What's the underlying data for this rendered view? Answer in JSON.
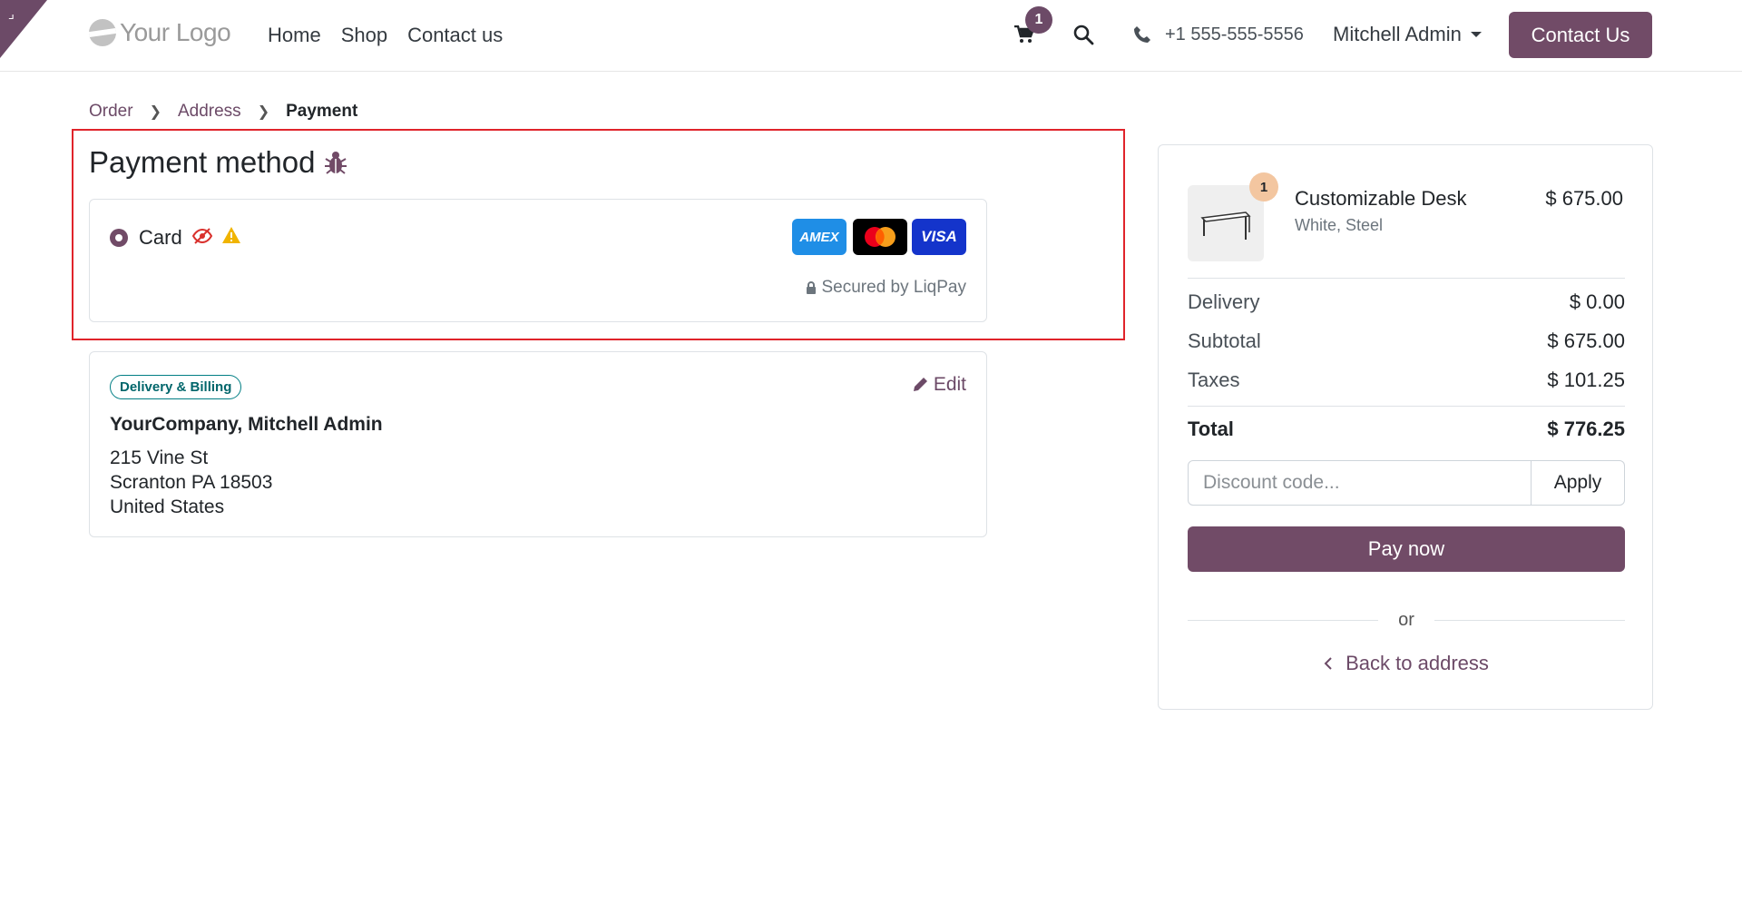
{
  "header": {
    "logo_text": "Your Logo",
    "nav": [
      "Home",
      "Shop",
      "Contact us"
    ],
    "cart_count": "1",
    "phone": "+1 555-555-5556",
    "user": "Mitchell Admin",
    "contact_button": "Contact Us"
  },
  "breadcrumb": {
    "items": [
      "Order",
      "Address"
    ],
    "active": "Payment"
  },
  "payment": {
    "title": "Payment method",
    "method_label": "Card",
    "brands": [
      "AMEX",
      "VISA"
    ],
    "secured_by": "Secured by LiqPay"
  },
  "address": {
    "badge": "Delivery & Billing",
    "edit_label": "Edit",
    "name": "YourCompany, Mitchell Admin",
    "lines": [
      "215 Vine St",
      "Scranton PA 18503",
      "United States"
    ]
  },
  "summary": {
    "product": {
      "qty": "1",
      "name": "Customizable Desk",
      "variant": "White, Steel",
      "price": "$ 675.00"
    },
    "rows": [
      {
        "label": "Delivery",
        "value": "$ 0.00"
      },
      {
        "label": "Subtotal",
        "value": "$ 675.00"
      },
      {
        "label": "Taxes",
        "value": "$ 101.25"
      }
    ],
    "total_label": "Total",
    "total_value": "$ 776.25",
    "discount_placeholder": "Discount code...",
    "apply_label": "Apply",
    "pay_label": "Pay now",
    "or_label": "or",
    "back_label": "Back to address"
  },
  "colors": {
    "brand": "#714b67",
    "highlight": "#e0242b",
    "badge_teal": "#017e84"
  }
}
